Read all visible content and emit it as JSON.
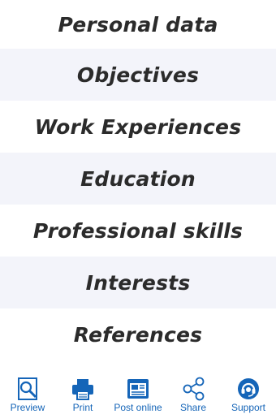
{
  "menu": {
    "items": [
      {
        "label": "Personal data"
      },
      {
        "label": "Objectives"
      },
      {
        "label": "Work Experiences"
      },
      {
        "label": "Education"
      },
      {
        "label": "Professional skills"
      },
      {
        "label": "Interests"
      },
      {
        "label": "References"
      }
    ]
  },
  "tabbar": {
    "tabs": [
      {
        "label": "Preview",
        "icon": "magnifier-icon"
      },
      {
        "label": "Print",
        "icon": "printer-icon"
      },
      {
        "label": "Post online",
        "icon": "browser-icon"
      },
      {
        "label": "Share",
        "icon": "share-icon"
      },
      {
        "label": "Support",
        "icon": "headset-icon"
      }
    ]
  },
  "colors": {
    "accent": "#1565b8",
    "row_alt": "#f3f4fa",
    "text": "#2b2b2b"
  }
}
